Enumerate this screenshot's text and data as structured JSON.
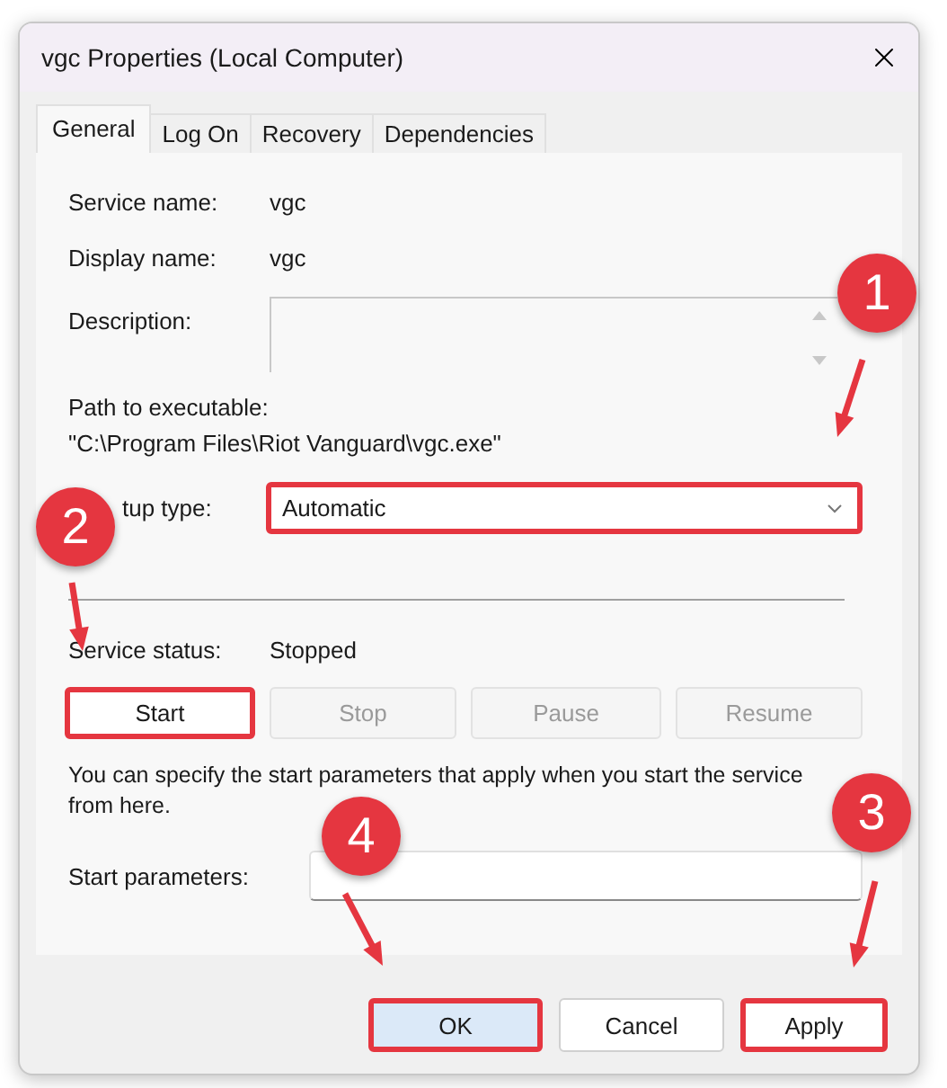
{
  "window": {
    "title": "vgc Properties (Local Computer)"
  },
  "tabs": [
    {
      "label": "General",
      "selected": true
    },
    {
      "label": "Log On",
      "selected": false
    },
    {
      "label": "Recovery",
      "selected": false
    },
    {
      "label": "Dependencies",
      "selected": false
    }
  ],
  "general": {
    "service_name": {
      "label": "Service name:",
      "value": "vgc"
    },
    "display_name": {
      "label": "Display name:",
      "value": "vgc"
    },
    "description": {
      "label": "Description:"
    },
    "path": {
      "label": "Path to executable:",
      "value": "\"C:\\Program Files\\Riot Vanguard\\vgc.exe\""
    },
    "startup_type": {
      "label": "tup type:",
      "value": "Automatic",
      "highlighted": true
    },
    "service_status": {
      "label": "Service status:",
      "value": "Stopped"
    },
    "control_buttons": [
      {
        "label": "Start",
        "disabled": false,
        "highlighted": true
      },
      {
        "label": "Stop",
        "disabled": true,
        "highlighted": false
      },
      {
        "label": "Pause",
        "disabled": true,
        "highlighted": false
      },
      {
        "label": "Resume",
        "disabled": true,
        "highlighted": false
      }
    ],
    "hint": "You can specify the start parameters that apply when you start the service from here.",
    "start_parameters": {
      "label": "Start parameters:"
    }
  },
  "buttons": [
    {
      "label": "OK",
      "default": true,
      "highlighted": true
    },
    {
      "label": "Cancel",
      "default": false,
      "highlighted": false
    },
    {
      "label": "Apply",
      "default": false,
      "highlighted": true
    }
  ],
  "annotations": [
    {
      "label": "1"
    },
    {
      "label": "2"
    },
    {
      "label": "3"
    },
    {
      "label": "4"
    }
  ]
}
